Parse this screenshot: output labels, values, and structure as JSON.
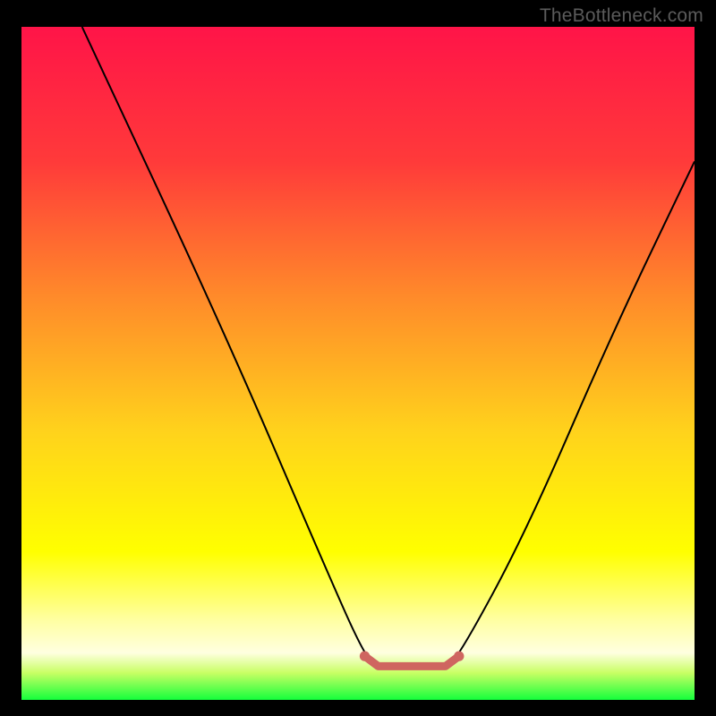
{
  "watermark": "TheBottleneck.com",
  "chart_data": {
    "type": "line",
    "title": "",
    "xlabel": "",
    "ylabel": "",
    "xlim": [
      0,
      100
    ],
    "ylim": [
      0,
      100
    ],
    "gradient_stops": [
      {
        "offset": 0,
        "color": "#ff1448"
      },
      {
        "offset": 20,
        "color": "#ff3a3a"
      },
      {
        "offset": 40,
        "color": "#ff8a2a"
      },
      {
        "offset": 60,
        "color": "#ffd21c"
      },
      {
        "offset": 78,
        "color": "#ffff00"
      },
      {
        "offset": 88,
        "color": "#ffffa0"
      },
      {
        "offset": 93,
        "color": "#ffffe0"
      },
      {
        "offset": 96,
        "color": "#c8ff64"
      },
      {
        "offset": 100,
        "color": "#14ff3c"
      }
    ],
    "series": [
      {
        "name": "bottleneck-curve",
        "color": "#000000",
        "points": [
          {
            "x": 9,
            "y": 100
          },
          {
            "x": 30,
            "y": 55
          },
          {
            "x": 45,
            "y": 20
          },
          {
            "x": 51,
            "y": 6.5
          },
          {
            "x": 53,
            "y": 5
          },
          {
            "x": 63,
            "y": 5
          },
          {
            "x": 65,
            "y": 6.5
          },
          {
            "x": 75,
            "y": 25
          },
          {
            "x": 88,
            "y": 55
          },
          {
            "x": 100,
            "y": 80
          }
        ]
      },
      {
        "name": "flat-band",
        "color": "#cf6560",
        "points": [
          {
            "x": 51,
            "y": 6.5
          },
          {
            "x": 53,
            "y": 5
          },
          {
            "x": 63,
            "y": 5
          },
          {
            "x": 65,
            "y": 6.5
          }
        ]
      }
    ]
  }
}
